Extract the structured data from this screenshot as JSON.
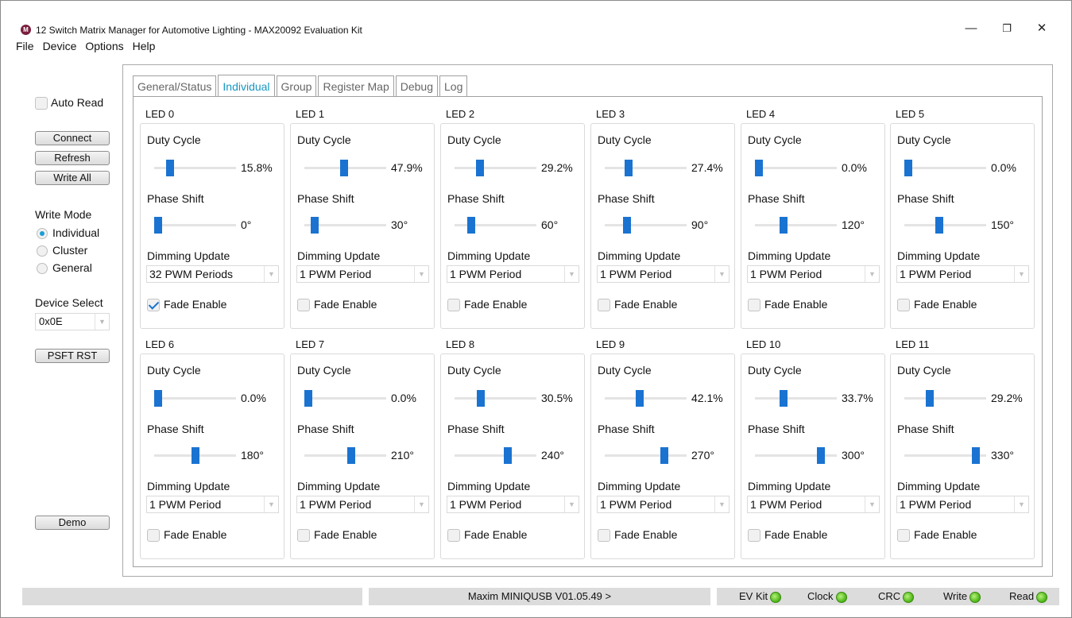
{
  "window": {
    "title": "12 Switch Matrix Manager for Automotive Lighting - MAX20092 Evaluation Kit",
    "logo_icon": "maxim-logo-icon"
  },
  "menu": [
    "File",
    "Device",
    "Options",
    "Help"
  ],
  "left_panel": {
    "auto_read_label": "Auto Read",
    "connect_label": "Connect",
    "refresh_label": "Refresh",
    "write_all_label": "Write All",
    "write_mode_label": "Write Mode",
    "write_modes": [
      "Individual",
      "Cluster",
      "General"
    ],
    "write_mode_selected": "Individual",
    "device_select_label": "Device Select",
    "device_select_value": "0x0E",
    "psft_rst_label": "PSFT RST",
    "demo_label": "Demo"
  },
  "tabs": [
    "General/Status",
    "Individual",
    "Group",
    "Register Map",
    "Debug",
    "Log"
  ],
  "active_tab": "Individual",
  "labels": {
    "duty_cycle": "Duty Cycle",
    "phase_shift": "Phase Shift",
    "dimming_update": "Dimming Update",
    "fade_enable": "Fade Enable"
  },
  "leds": [
    {
      "name": "LED 0",
      "duty": 15.8,
      "duty_text": "15.8%",
      "phase": 0,
      "phase_text": "0°",
      "dimming": "32 PWM Periods",
      "fade": true
    },
    {
      "name": "LED 1",
      "duty": 47.9,
      "duty_text": "47.9%",
      "phase": 30,
      "phase_text": "30°",
      "dimming": "1 PWM Period",
      "fade": false
    },
    {
      "name": "LED 2",
      "duty": 29.2,
      "duty_text": "29.2%",
      "phase": 60,
      "phase_text": "60°",
      "dimming": "1 PWM Period",
      "fade": false
    },
    {
      "name": "LED 3",
      "duty": 27.4,
      "duty_text": "27.4%",
      "phase": 90,
      "phase_text": "90°",
      "dimming": "1 PWM Period",
      "fade": false
    },
    {
      "name": "LED 4",
      "duty": 0.0,
      "duty_text": "0.0%",
      "phase": 120,
      "phase_text": "120°",
      "dimming": "1 PWM Period",
      "fade": false
    },
    {
      "name": "LED 5",
      "duty": 0.0,
      "duty_text": "0.0%",
      "phase": 150,
      "phase_text": "150°",
      "dimming": "1 PWM Period",
      "fade": false
    },
    {
      "name": "LED 6",
      "duty": 0.0,
      "duty_text": "0.0%",
      "phase": 180,
      "phase_text": "180°",
      "dimming": "1 PWM Period",
      "fade": false
    },
    {
      "name": "LED 7",
      "duty": 0.0,
      "duty_text": "0.0%",
      "phase": 210,
      "phase_text": "210°",
      "dimming": "1 PWM Period",
      "fade": false
    },
    {
      "name": "LED 8",
      "duty": 30.5,
      "duty_text": "30.5%",
      "phase": 240,
      "phase_text": "240°",
      "dimming": "1 PWM Period",
      "fade": false
    },
    {
      "name": "LED 9",
      "duty": 42.1,
      "duty_text": "42.1%",
      "phase": 270,
      "phase_text": "270°",
      "dimming": "1 PWM Period",
      "fade": false
    },
    {
      "name": "LED 10",
      "duty": 33.7,
      "duty_text": "33.7%",
      "phase": 300,
      "phase_text": "300°",
      "dimming": "1 PWM Period",
      "fade": false
    },
    {
      "name": "LED 11",
      "duty": 29.2,
      "duty_text": "29.2%",
      "phase": 330,
      "phase_text": "330°",
      "dimming": "1 PWM Period",
      "fade": false
    }
  ],
  "status_bar": {
    "adapter": "Maxim MINIQUSB V01.05.49 >",
    "indicators": [
      "EV Kit",
      "Clock",
      "CRC",
      "Write",
      "Read"
    ],
    "indicator_color": "#48b414"
  },
  "colors": {
    "accent": "#1897c2",
    "slider_thumb": "#1a73d1"
  }
}
